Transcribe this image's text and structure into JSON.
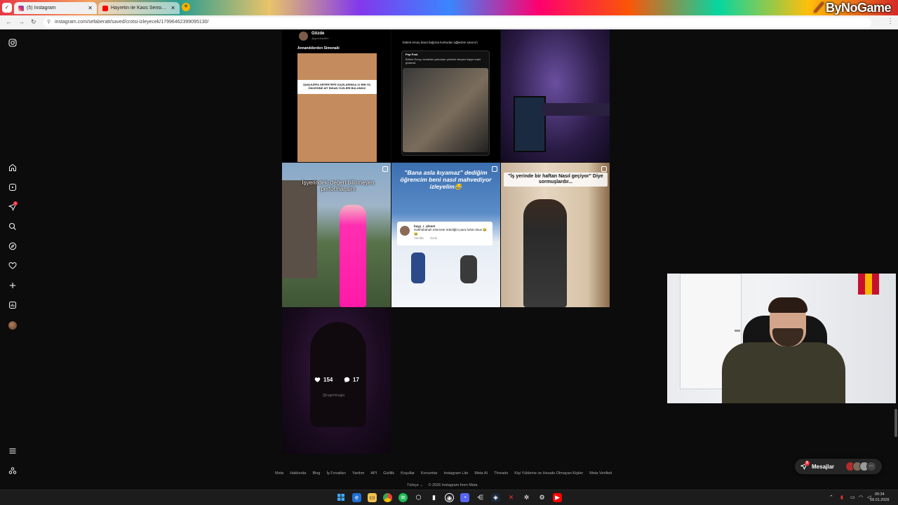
{
  "browser": {
    "tabs": [
      {
        "title": "(5) Instagram",
        "active": true
      },
      {
        "title": "Hayretin ile Kaos Serisi - 2 Saat",
        "active": false
      }
    ],
    "url": "instagram.com/sefaberatt/saved/crotsi-izleyecek/17996462399095130/",
    "new_tab_symbol": "+",
    "brand": "ByNoGame"
  },
  "sidebar": {
    "notification_count": "1",
    "icons": [
      "instagram-icon",
      "home-icon",
      "reels-icon",
      "messages-icon",
      "search-icon",
      "explore-icon",
      "heart-icon",
      "create-icon",
      "dashboard-icon",
      "profile-avatar",
      "menu-icon",
      "threads-icon"
    ]
  },
  "posts": {
    "p1": {
      "name": "Gözde",
      "handle": "@gozdeyebiri",
      "text": "Annanıkilerden Simonaki",
      "headline": "ŞANLIURFA SEFERTEPE KAZILARINDA 12 BİN YIL ÖNCESİNE AİT İNSAN YÜZLERİ BULUNDU!"
    },
    "p2": {
      "top_text": "bülent ersoy bana bağırsa korkudan ağlardım sanırım",
      "card_name": "Pop Post",
      "card_text": "Bülent Ersoy, kendisini yakından çekmek isteyen kişiye tepki gösterdi."
    },
    "p4": {
      "caption": "İşyerindeki değeri bilinmeyen performansım"
    },
    "p5": {
      "caption": "\"Bana asla kıyamaz\" dediğim öğrencim beni nasıl mahvediyor izleyelim😂",
      "comment_user": "bayy_r_ahmet",
      "comment_text": "Hahhahahah internete ödediğim para helal olsun 😂😂",
      "comment_reply": "Yanıtla",
      "comment_hide": "Gizle"
    },
    "p6": {
      "caption": "\"İş yerinde bir haftan Nasıl geçiyor\" Diye sormuşlardır..."
    },
    "p7": {
      "likes": "154",
      "comments": "17",
      "watermark": "@rugemkugla"
    }
  },
  "footer": {
    "links": [
      "Meta",
      "Hakkında",
      "Blog",
      "İş Fırsatları",
      "Yardım",
      "API",
      "Gizlilik",
      "Koşullar",
      "Konumlar",
      "Instagram Lite",
      "Meta AI",
      "Threads",
      "Kişi Yükleme ve Hesabı Olmayan Kişiler",
      "Meta Verified"
    ],
    "language": "Türkçe",
    "copyright": "© 2026 Instagram from Meta"
  },
  "messages": {
    "label": "Mesajlar",
    "badge": "5"
  },
  "taskbar": {
    "time": "00:34",
    "date": "18.01.2026",
    "apps": [
      "windows-start",
      "edge",
      "file-explorer",
      "chrome",
      "spotify",
      "app-cube",
      "app-store",
      "obs",
      "discord",
      "capcut",
      "steam",
      "app-x",
      "app-settings",
      "app-gear",
      "youtube"
    ]
  },
  "colors": {
    "background": "#0c0c0c",
    "badge": "#ff3040",
    "pill": "#262626"
  }
}
